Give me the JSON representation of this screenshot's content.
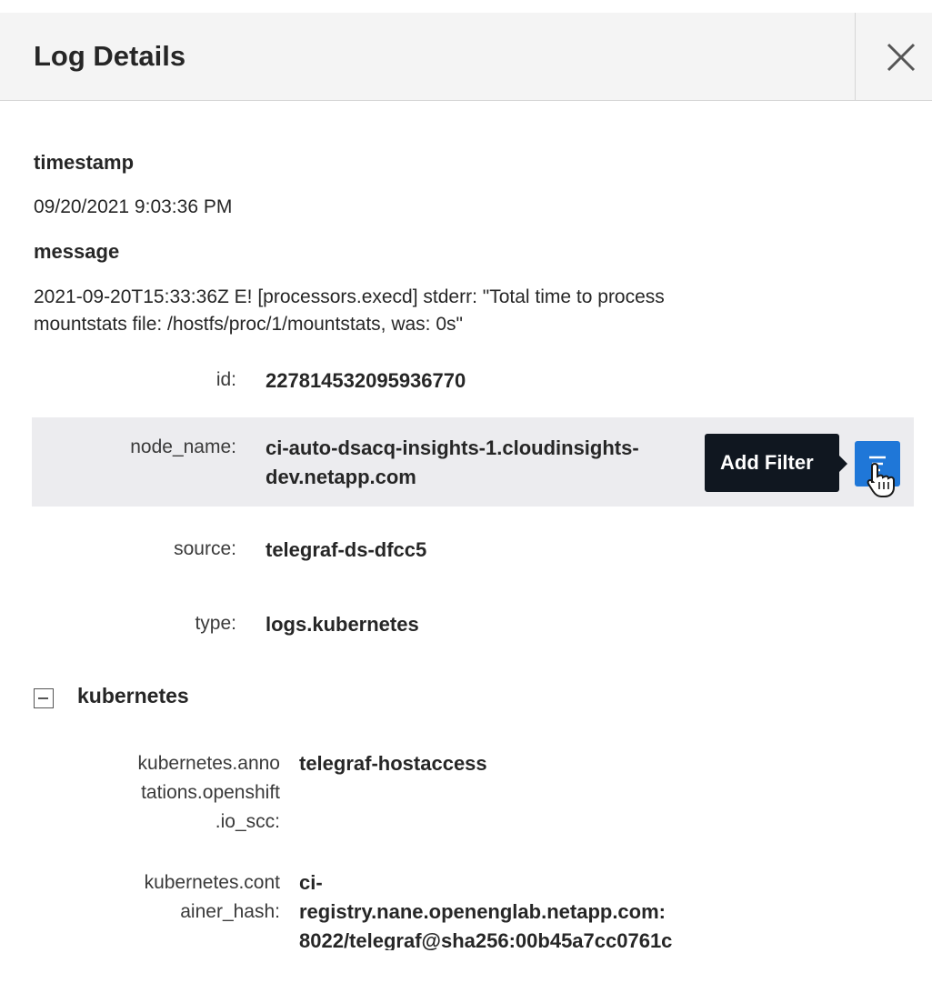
{
  "header": {
    "title": "Log Details",
    "close_icon": "close-icon"
  },
  "fields": {
    "timestamp_label": "timestamp",
    "timestamp_value": "09/20/2021 9:03:36 PM",
    "message_label": "message",
    "message_line1": "2021-09-20T15:33:36Z E! [processors.execd] stderr: \"Total time to process",
    "message_line2": "mountstats file: /hostfs/proc/1/mountstats, was: 0s\""
  },
  "attributes": [
    {
      "key": "id:",
      "value": "227814532095936770"
    },
    {
      "key": "node_name:",
      "value_line1": "ci-auto-dsacq-insights-1.cloudinsights-",
      "value_line2": "dev.netapp.com"
    },
    {
      "key": "source:",
      "value": "telegraf-ds-dfcc5"
    },
    {
      "key": "type:",
      "value": "logs.kubernetes"
    }
  ],
  "tooltip": {
    "text": "Add Filter"
  },
  "kubernetes": {
    "group_label": "kubernetes",
    "rows": [
      {
        "key_line1": "kubernetes.anno",
        "key_line2": "tations.openshift",
        "key_line3": ".io_scc:",
        "value": "telegraf-hostaccess"
      },
      {
        "key_line1": "kubernetes.cont",
        "key_line2": "ainer_hash:",
        "value_line1": "ci-",
        "value_line2": "registry.nane.openenglab.netapp.com:",
        "value_line3": "8022/telegraf@sha256:00b45a7cc0761c"
      }
    ]
  },
  "colors": {
    "accent": "#1f77d8",
    "tooltip_bg": "#101720",
    "row_highlight": "#ececef"
  }
}
